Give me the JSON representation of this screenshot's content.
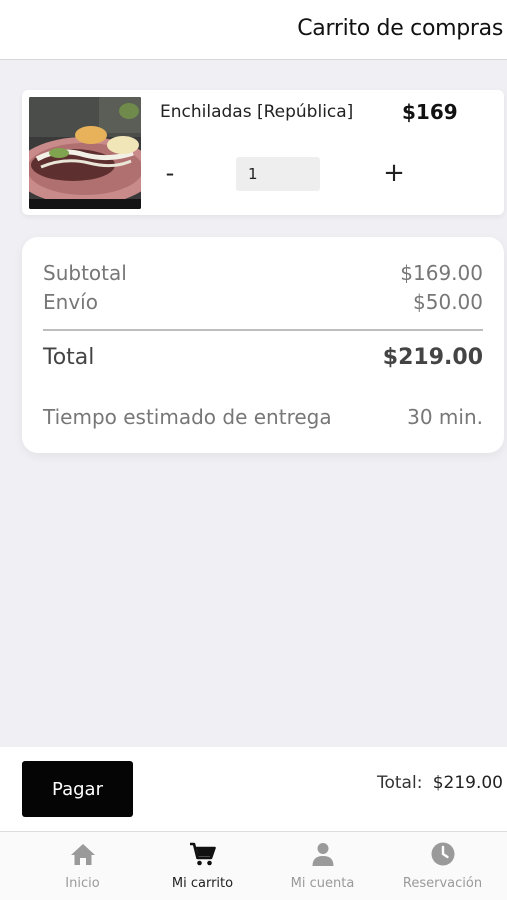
{
  "header": {
    "title": "Carrito de compras"
  },
  "cart": {
    "items": [
      {
        "name": "Enchiladas [República]",
        "price": "$169",
        "quantity": "1",
        "minus_label": "-",
        "plus_label": "+"
      }
    ]
  },
  "summary": {
    "subtotal_label": "Subtotal",
    "subtotal_value": "$169.00",
    "shipping_label": "Envío",
    "shipping_value": "$50.00",
    "total_label": "Total",
    "total_value": "$219.00",
    "delivery_label": "Tiempo estimado de entrega",
    "delivery_value": "30 min."
  },
  "checkout": {
    "pay_label": "Pagar",
    "total_label": "Total:",
    "total_value": "$219.00"
  },
  "tabs": [
    {
      "label": "Inicio",
      "icon": "home-icon",
      "active": false
    },
    {
      "label": "Mi carrito",
      "icon": "cart-icon",
      "active": true
    },
    {
      "label": "Mi cuenta",
      "icon": "user-icon",
      "active": false
    },
    {
      "label": "Reservación",
      "icon": "clock-icon",
      "active": false
    }
  ],
  "colors": {
    "active_tab": "#111111",
    "inactive_tab": "#9a9a9a",
    "pay_button": "#050505"
  }
}
